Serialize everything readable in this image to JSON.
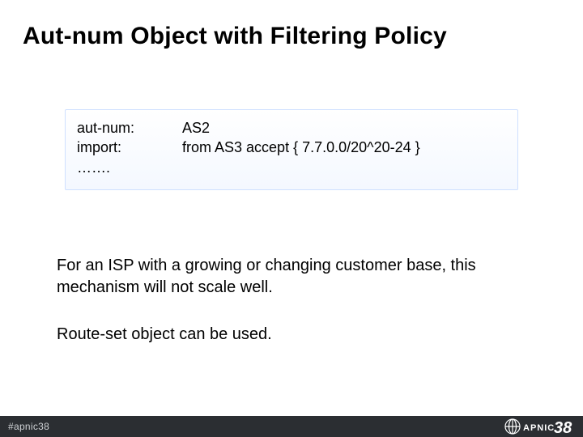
{
  "slide": {
    "title": "Aut-num Object with Filtering Policy",
    "code": {
      "rows": [
        {
          "key": "aut-num:",
          "val": "AS2"
        },
        {
          "key": "import:",
          "val": "from AS3 accept { 7.7.0.0/20^20-24 }"
        },
        {
          "key": "…….",
          "val": ""
        }
      ]
    },
    "paragraph1": "For an ISP with a growing or changing customer base, this mechanism will not scale well.",
    "paragraph2": "Route-set object can be used."
  },
  "footer": {
    "hashtag": "#apnic38",
    "logo_text": "APNIC",
    "conf_number": "38"
  }
}
